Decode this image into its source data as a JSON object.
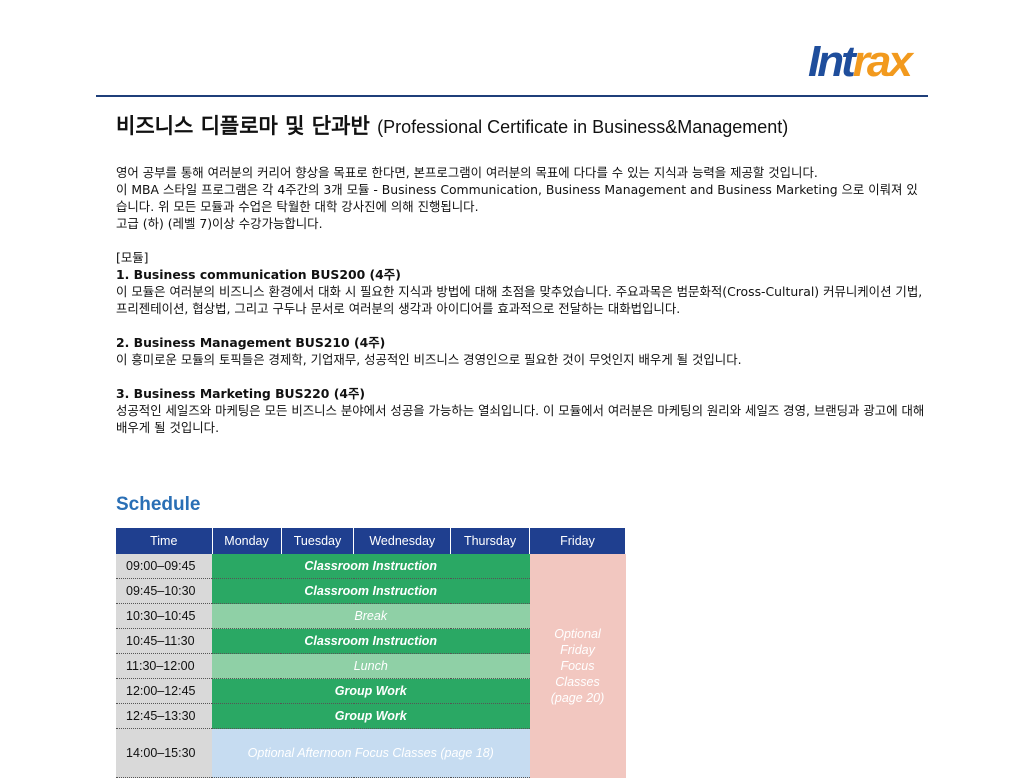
{
  "logo": {
    "part1": "Int",
    "part2": "rax"
  },
  "heading": {
    "title": "비즈니스 디플로마 및 단과반",
    "subtitle": "(Professional Certificate in Business&Management)"
  },
  "intro": [
    "영어 공부를 통해 여러분의 커리어 향상을 목표로 한다면, 본프로그램이 여러분의 목표에 다다를 수 있는 지식과 능력을 제공할 것입니다.",
    "이 MBA 스타일 프로그램은 각 4주간의 3개 모듈 - Business Communication, Business Management and Business Marketing 으로 이뤄져 있습니다. 위 모든 모듈과 수업은 탁월한 대학 강사진에 의해 진행됩니다.",
    "고급 (하) (레벨 7)이상 수강가능합니다."
  ],
  "modules_label": "[모듈]",
  "modules": [
    {
      "heading": "1. Business communication BUS200 (4주)",
      "text": "이 모듈은 여러분의 비즈니스 환경에서 대화 시 필요한 지식과 방법에 대해 초점을 맞추었습니다. 주요과목은 범문화적(Cross-Cultural) 커뮤니케이션 기법, 프리젠테이션, 협상법, 그리고 구두나 문서로 여러분의 생각과 아이디어를 효과적으로 전달하는 대화법입니다."
    },
    {
      "heading": "2. Business Management BUS210 (4주)",
      "text": "이 흥미로운 모듈의 토픽들은 경제학, 기업재무, 성공적인 비즈니스 경영인으로 필요한 것이 무엇인지 배우게 될 것입니다."
    },
    {
      "heading": "3. Business Marketing BUS220 (4주)",
      "text": "성공적인 세일즈와 마케팅은 모든 비즈니스 분야에서 성공을 가능하는 열쇠입니다. 이 모듈에서 여러분은 마케팅의 원리와 세일즈 경영, 브랜딩과 광고에 대해 배우게 될 것입니다."
    }
  ],
  "schedule": {
    "title": "Schedule",
    "headers": [
      "Time",
      "Monday",
      "Tuesday",
      "Wednesday",
      "Thursday",
      "Friday"
    ],
    "rows": [
      {
        "time": "09:00–09:45",
        "activity": "Classroom Instruction"
      },
      {
        "time": "09:45–10:30",
        "activity": "Classroom Instruction"
      },
      {
        "time": "10:30–10:45",
        "activity": "Break"
      },
      {
        "time": "10:45–11:30",
        "activity": "Classroom Instruction"
      },
      {
        "time": "11:30–12:00",
        "activity": "Lunch"
      },
      {
        "time": "12:00–12:45",
        "activity": "Group Work"
      },
      {
        "time": "12:45–13:30",
        "activity": "Group Work"
      },
      {
        "time": "14:00–15:30",
        "activity": "Optional Afternoon Focus Classes (page 18)"
      }
    ],
    "friday": [
      "Optional",
      "Friday",
      "Focus",
      "Classes",
      "(page 20)"
    ]
  },
  "colors": {
    "header": "#1f3f8f",
    "instruction": "#2aa864",
    "break": "#8fd0a6",
    "friday": "#f2c7c0",
    "afternoon": "#c6dcf1"
  }
}
